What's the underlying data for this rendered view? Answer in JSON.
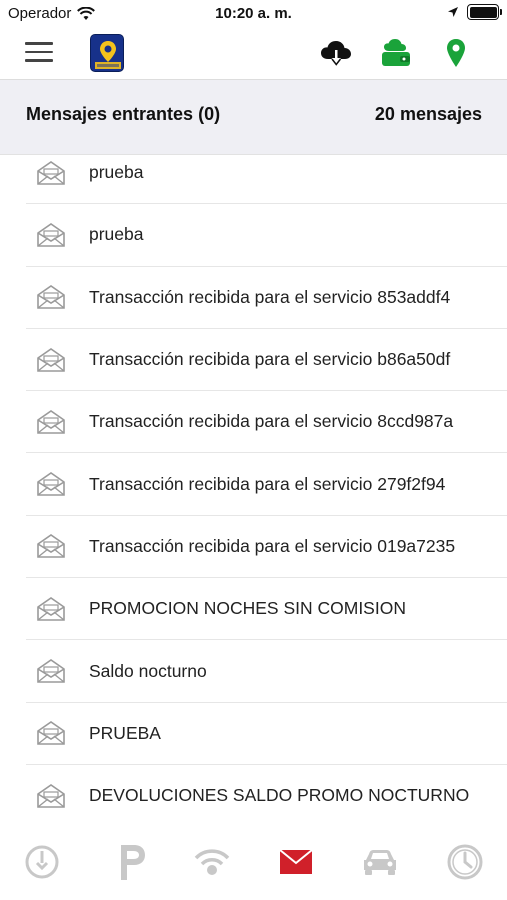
{
  "status_bar": {
    "carrier": "Operador",
    "time": "10:20 a. m."
  },
  "navbar": {
    "actions": [
      {
        "icon": "cloud-download-icon",
        "color": "#111111"
      },
      {
        "icon": "cloud-wallet-icon",
        "color": "#1aa33a"
      },
      {
        "icon": "map-pin-icon",
        "color": "#1aa33a"
      }
    ]
  },
  "header": {
    "title": "Mensajes entrantes (0)",
    "count": "20 mensajes"
  },
  "messages": [
    "prueba",
    "prueba",
    "Transacción recibida para el servicio 853addf4",
    "Transacción recibida para el servicio b86a50df",
    "Transacción recibida para el servicio 8ccd987a",
    "Transacción recibida para el servicio 279f2f94",
    "Transacción recibida para el servicio 019a7235",
    "PROMOCION NOCHES SIN COMISION",
    "Saldo nocturno",
    "PRUEBA",
    "DEVOLUCIONES SALDO PROMO NOCTURNO"
  ],
  "tabs": [
    {
      "name": "power",
      "icon": "power-icon",
      "active": false
    },
    {
      "name": "parking",
      "icon": "parking-icon",
      "active": false
    },
    {
      "name": "signal",
      "icon": "wifi-signal-icon",
      "active": false
    },
    {
      "name": "messages",
      "icon": "mail-icon",
      "active": true
    },
    {
      "name": "car",
      "icon": "car-icon",
      "active": false
    },
    {
      "name": "history",
      "icon": "clock-icon",
      "active": false
    }
  ],
  "colors": {
    "accent": "#d0202a",
    "inactive_tab": "#c8c8c8",
    "green": "#1aa33a"
  }
}
